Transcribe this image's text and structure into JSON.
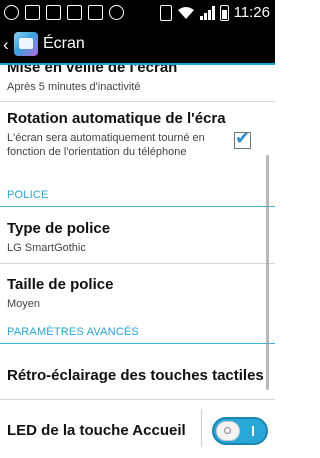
{
  "status_bar": {
    "time": "11:26",
    "left_icons": [
      "search-icon",
      "sd-card-icon",
      "notification-icon",
      "image-icon",
      "email-icon",
      "settings-icon"
    ],
    "right_icons": [
      "vibrate-icon",
      "wifi-icon",
      "signal-icon",
      "battery-icon"
    ]
  },
  "action_bar": {
    "title": "Écran"
  },
  "settings": {
    "sleep": {
      "title": "Mise en veille de l'écran",
      "summary": "Après 5 minutes d'inactivité"
    },
    "rotation": {
      "title": "Rotation automatique de l'écra",
      "summary": "L'écran sera automatiquement tourné en fonction de l'orientation du téléphone",
      "checked": true
    },
    "section_police": "POLICE",
    "font_type": {
      "title": "Type de police",
      "summary": "LG SmartGothic"
    },
    "font_size": {
      "title": "Taille de police",
      "summary": "Moyen"
    },
    "section_advanced": "PARAMÈTRES AVANCÉS",
    "backlight": {
      "title": "Rétro-éclairage des touches tactiles"
    },
    "home_led": {
      "title": "LED de la touche Accueil",
      "enabled": true
    }
  },
  "colors": {
    "accent": "#29a7d7",
    "section_text": "#2aa2cf"
  }
}
